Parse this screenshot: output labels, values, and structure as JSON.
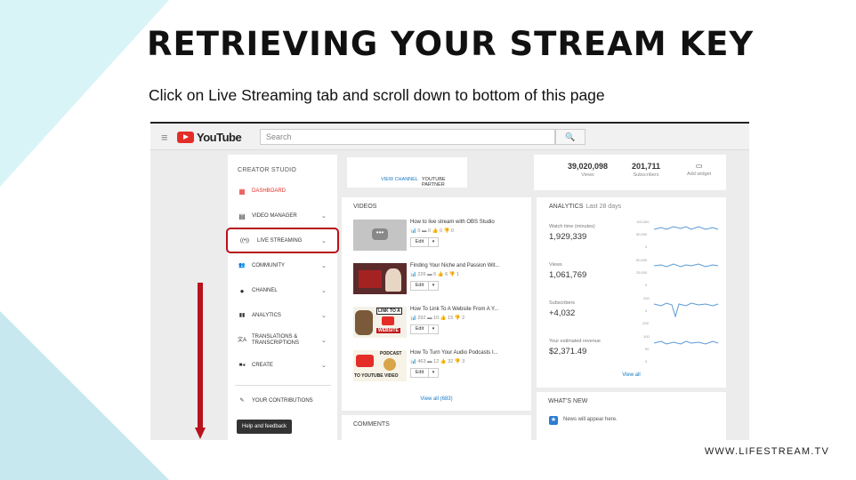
{
  "slide": {
    "title": "RETRIEVING YOUR STREAM KEY",
    "subtitle": "Click on Live Streaming tab and scroll down to bottom of this page",
    "footer": "WWW.LIFESTREAM.TV",
    "accent_color": "#b8121c"
  },
  "youtube": {
    "logo_text": "YouTube",
    "search_placeholder": "Search",
    "search_icon": "magnifier-icon"
  },
  "sidebar": {
    "section_title": "CREATOR STUDIO",
    "items": [
      {
        "label": "DASHBOARD",
        "icon": "dashboard-icon",
        "glyph": "▦",
        "chevron": false
      },
      {
        "label": "VIDEO MANAGER",
        "icon": "video-manager-icon",
        "glyph": "▤",
        "chevron": true
      },
      {
        "label": "LIVE STREAMING",
        "icon": "live-streaming-icon",
        "glyph": "((•))",
        "chevron": true
      },
      {
        "label": "COMMUNITY",
        "icon": "community-icon",
        "glyph": "👥",
        "chevron": true
      },
      {
        "label": "CHANNEL",
        "icon": "channel-icon",
        "glyph": "●",
        "chevron": true
      },
      {
        "label": "ANALYTICS",
        "icon": "analytics-icon",
        "glyph": "▮▮",
        "chevron": true
      },
      {
        "label": "TRANSLATIONS & TRANSCRIPTIONS",
        "icon": "translations-icon",
        "glyph": "文A",
        "chevron": true
      },
      {
        "label": "CREATE",
        "icon": "create-icon",
        "glyph": "■◂",
        "chevron": true
      }
    ],
    "contributions": "YOUR CONTRIBUTIONS",
    "help": "Help and feedback"
  },
  "channel": {
    "view_channel": "VIEW CHANNEL",
    "partner": "YOUTUBE PARTNER"
  },
  "stats": {
    "views_num": "39,020,098",
    "views_cap": "Views",
    "subs_num": "201,711",
    "subs_cap": "Subscribers",
    "widget_cap": "Add widget"
  },
  "videos": {
    "header": "VIDEOS",
    "items": [
      {
        "title": "How to live stream with OBS Studio",
        "stats": "📊 0  ▬ 0  👍 0  👎 0"
      },
      {
        "title": "Finding Your Niche and Passion Wit...",
        "stats": "📊 226  ▬ 6  👍 6  👎 1"
      },
      {
        "title": "How To Link To A Website From A Y...",
        "stats": "📊 292  ▬ 10  👍 15  👎 2"
      },
      {
        "title": "How To Turn Your Audio Podcasts I...",
        "stats": "📊 463  ▬ 12  👍 32  👎 3"
      }
    ],
    "edit_label": "Edit",
    "thumb_texts": {
      "link": "LINK TO A",
      "website": "WEBSITE",
      "podcast": "PODCAST",
      "to_video": "TO YOUTUBE VIDEO"
    },
    "view_all": "View all (683)"
  },
  "comments": {
    "header": "COMMENTS"
  },
  "analytics": {
    "header": "ANALYTICS",
    "period": "Last 28 days",
    "metrics": [
      {
        "label": "Watch time (minutes)",
        "value": "1,929,339",
        "axis": [
          "100,000",
          "50,000",
          "0"
        ]
      },
      {
        "label": "Views",
        "value": "1,061,769",
        "axis": [
          "50,000",
          "25,000",
          "0"
        ]
      },
      {
        "label": "Subscribers",
        "value": "+4,032",
        "axis": [
          "200",
          "0",
          "-200"
        ]
      },
      {
        "label": "Your estimated revenue",
        "value": "$2,371.49",
        "axis": [
          "100",
          "50",
          "0"
        ]
      }
    ],
    "view_all": "View all"
  },
  "whats_new": {
    "header": "WHAT'S NEW",
    "text": "News will appear here."
  }
}
